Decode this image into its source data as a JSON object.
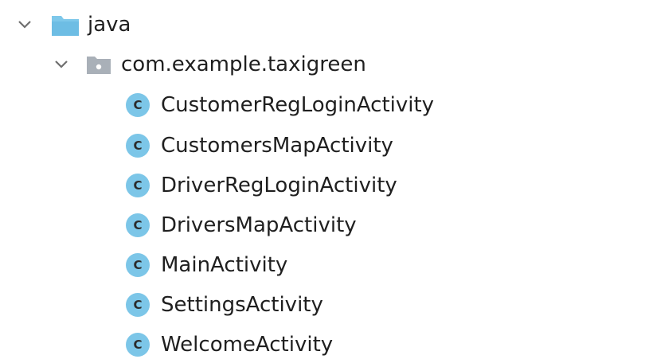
{
  "tree": {
    "root": {
      "label": "java",
      "icon": "folder-icon",
      "expanded": true
    },
    "package": {
      "label": "com.example.taxigreen",
      "icon": "package-icon",
      "expanded": true
    },
    "classes": [
      {
        "label": "CustomerRegLoginActivity",
        "icon": "class-icon"
      },
      {
        "label": "CustomersMapActivity",
        "icon": "class-icon"
      },
      {
        "label": "DriverRegLoginActivity",
        "icon": "class-icon"
      },
      {
        "label": "DriversMapActivity",
        "icon": "class-icon"
      },
      {
        "label": "MainActivity",
        "icon": "class-icon"
      },
      {
        "label": "SettingsActivity",
        "icon": "class-icon"
      },
      {
        "label": "WelcomeActivity",
        "icon": "class-icon"
      }
    ]
  },
  "colors": {
    "folder": "#7ec8ea",
    "package": "#a9b0b8",
    "class_badge": "#7cc6e8",
    "chevron": "#6f6f6f",
    "text": "#1f1f1f"
  }
}
